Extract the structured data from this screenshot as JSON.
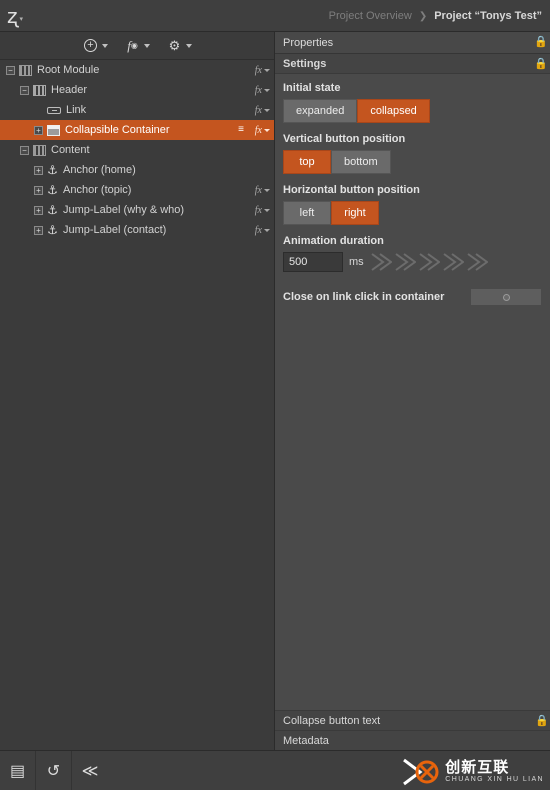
{
  "topbar": {
    "logo_glyph": "ʐ",
    "logo_caret": "▾",
    "breadcrumb": {
      "parent": "Project Overview",
      "separator": "❯",
      "current": "Project “Tonys Test”"
    }
  },
  "toolbar": {
    "items": [
      {
        "name": "add-element-button",
        "glyph": "+",
        "caret": true
      },
      {
        "name": "function-button",
        "glyph": "f",
        "caret": true
      },
      {
        "name": "settings-button",
        "glyph": "⚙",
        "caret": true
      }
    ]
  },
  "tree": {
    "rows": [
      {
        "label": "Root Module",
        "indent": 0,
        "expander": "−",
        "icon": "module-icon",
        "fx": true,
        "selected": false
      },
      {
        "label": "Header",
        "indent": 1,
        "expander": "−",
        "icon": "header-icon",
        "fx": true,
        "selected": false
      },
      {
        "label": "Link",
        "indent": 2,
        "expander": "",
        "icon": "link-icon",
        "fx": true,
        "selected": false
      },
      {
        "label": "Collapsible Container",
        "indent": 2,
        "expander": "+",
        "icon": "collapsible-icon",
        "fx": true,
        "selected": true
      },
      {
        "label": "Content",
        "indent": 1,
        "expander": "−",
        "icon": "module-icon",
        "fx": false,
        "selected": false
      },
      {
        "label": "Anchor (home)",
        "indent": 2,
        "expander": "+",
        "icon": "anchor-icon",
        "fx": false,
        "selected": false
      },
      {
        "label": "Anchor (topic)",
        "indent": 2,
        "expander": "+",
        "icon": "anchor-icon",
        "fx": true,
        "selected": false
      },
      {
        "label": "Jump-Label (why & who)",
        "indent": 2,
        "expander": "+",
        "icon": "anchor-icon",
        "fx": true,
        "selected": false
      },
      {
        "label": "Jump-Label (contact)",
        "indent": 2,
        "expander": "+",
        "icon": "anchor-icon",
        "fx": true,
        "selected": false
      }
    ],
    "fx_label": "fx"
  },
  "properties": {
    "title": "Properties",
    "settings_title": "Settings",
    "initial_state": {
      "label": "Initial state",
      "options": [
        "expanded",
        "collapsed"
      ],
      "selected": "collapsed"
    },
    "vertical_button_position": {
      "label": "Vertical button position",
      "options": [
        "top",
        "bottom"
      ],
      "selected": "top"
    },
    "horizontal_button_position": {
      "label": "Horizontal button position",
      "options": [
        "left",
        "right"
      ],
      "selected": "right"
    },
    "animation_duration": {
      "label": "Animation duration",
      "value": "500",
      "unit": "ms"
    },
    "close_on_link_click": {
      "label": "Close on link click in container",
      "checked": false
    },
    "footer_sections": [
      {
        "label": "Collapse button text",
        "locked": true
      },
      {
        "label": "Metadata",
        "locked": false
      }
    ]
  },
  "bottombar": {
    "buttons": [
      {
        "name": "save-button",
        "glyph": "▤"
      },
      {
        "name": "refresh-button",
        "glyph": "↺"
      },
      {
        "name": "collapse-button",
        "glyph": "≪"
      }
    ]
  },
  "watermark": {
    "cn": "创新互联",
    "en": "CHUANG XIN HU LIAN"
  },
  "colors": {
    "accent": "#c4551f",
    "panel": "#4a4a4a",
    "tree_bg": "#3b3b3b",
    "text": "#d2d2d2"
  }
}
